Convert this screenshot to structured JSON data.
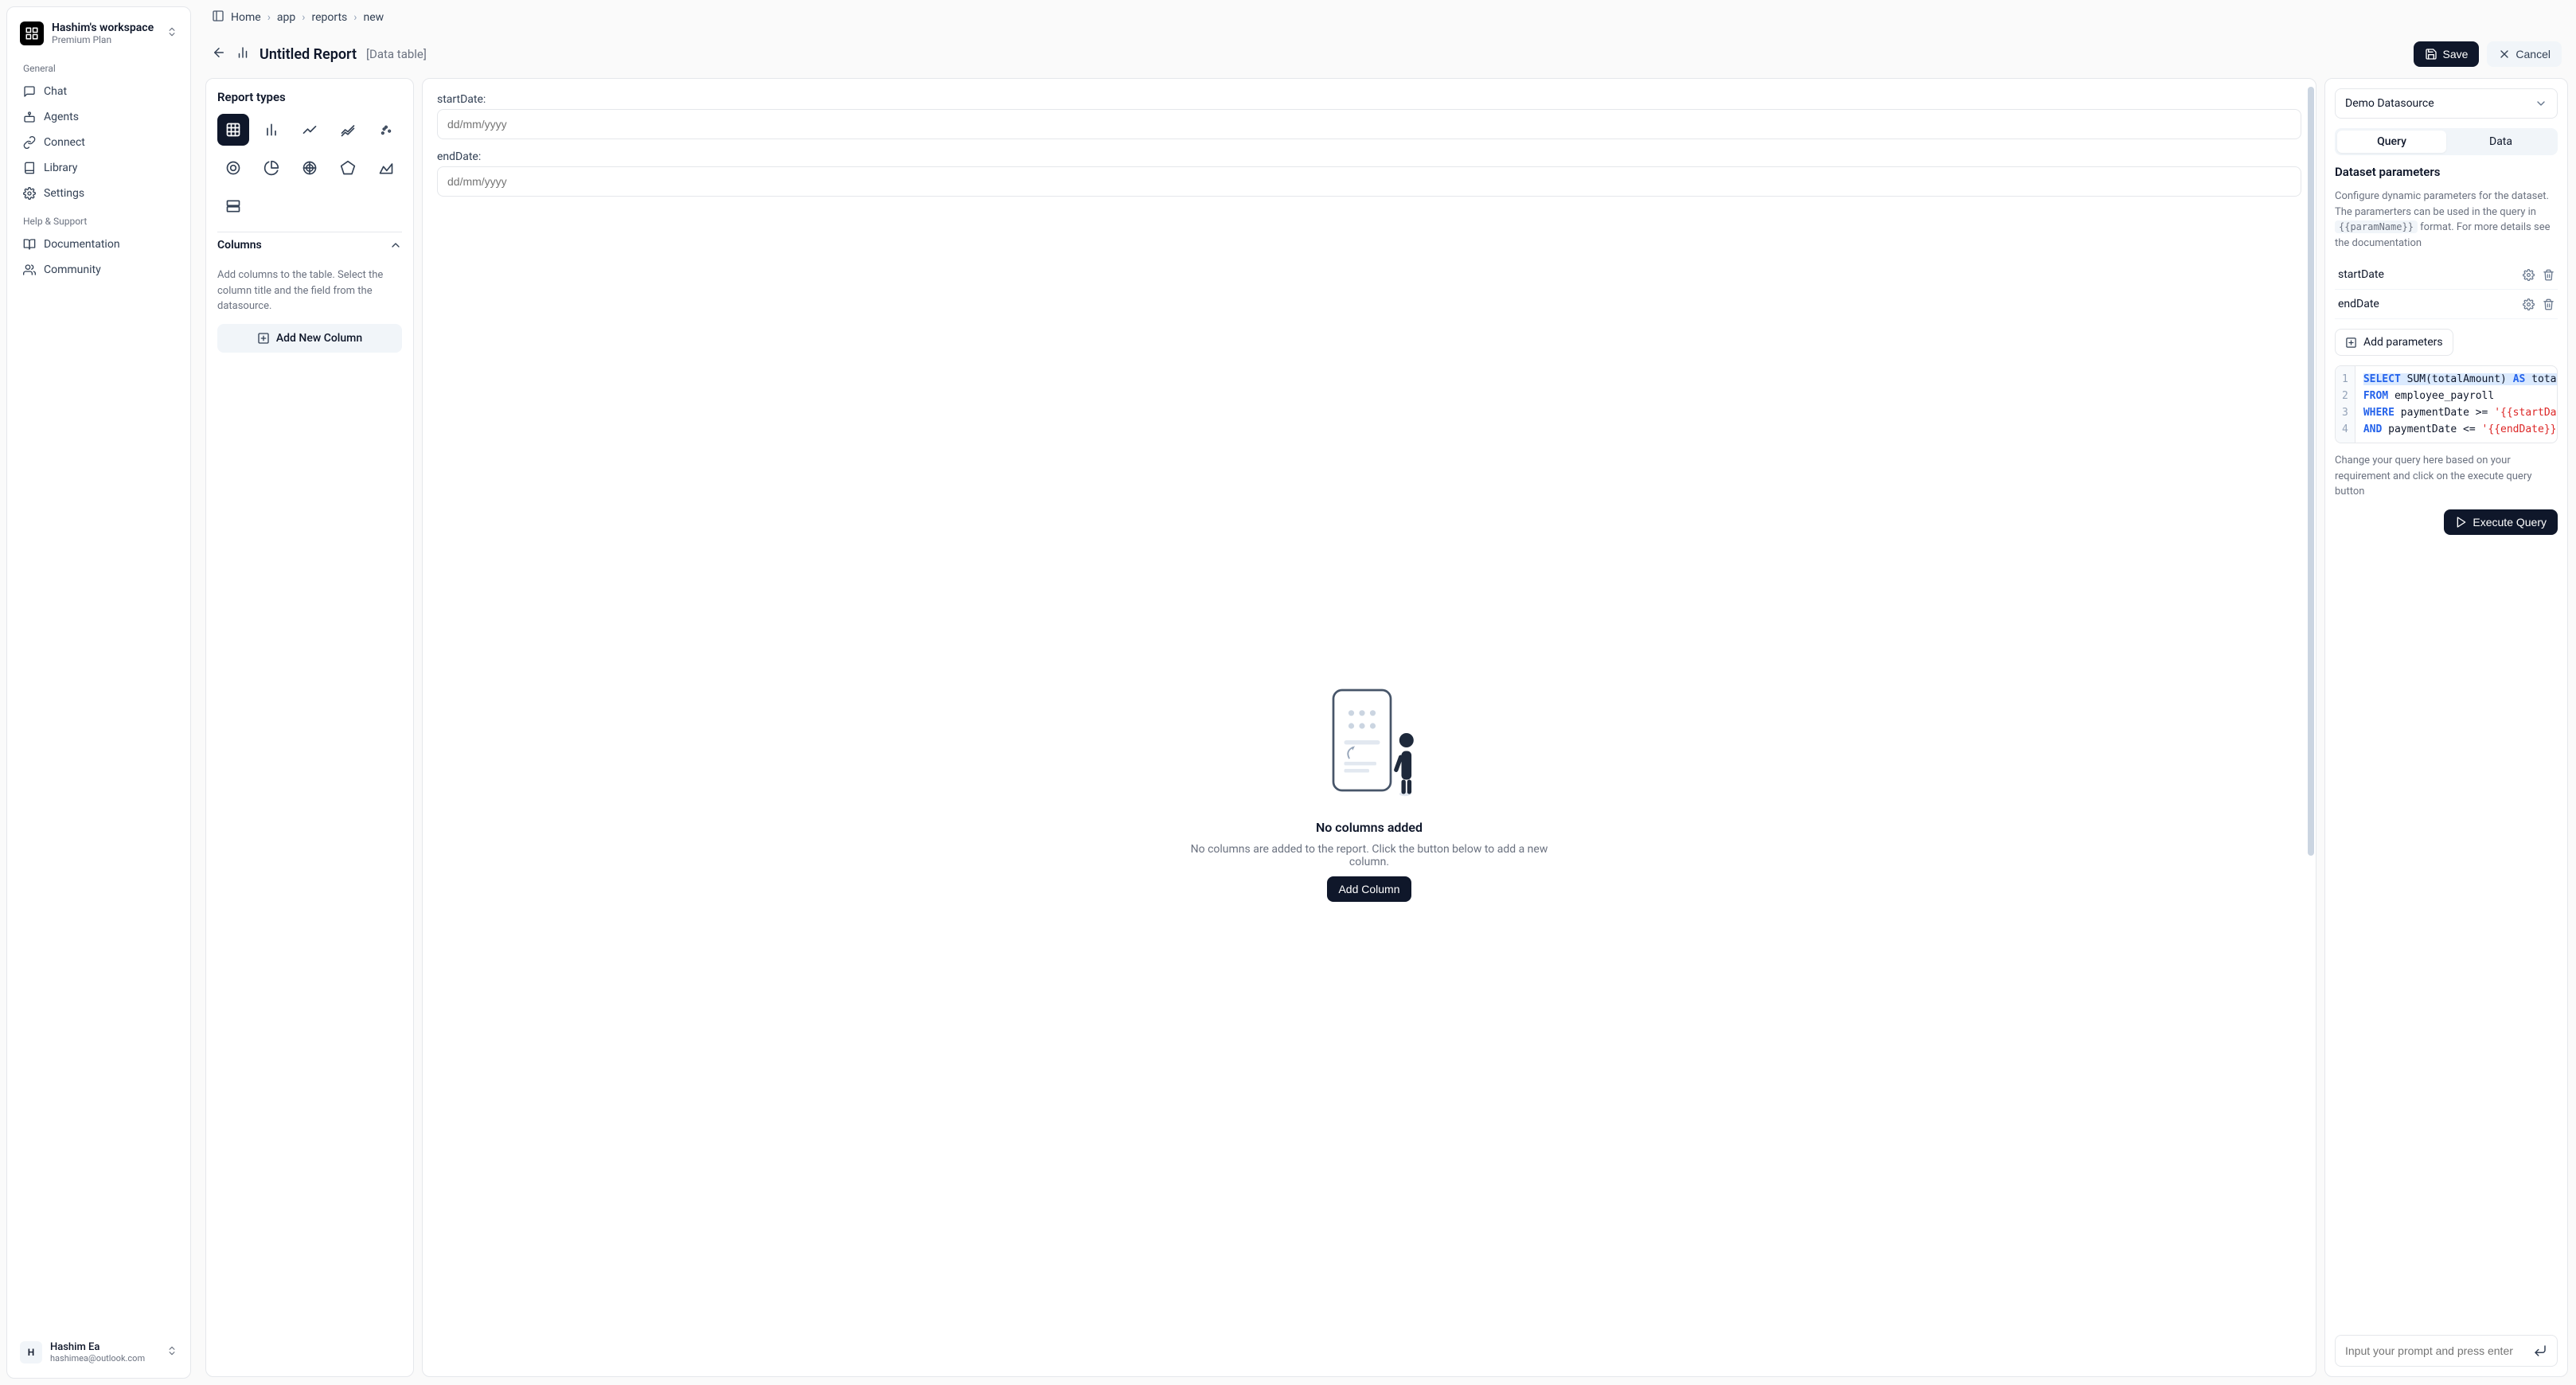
{
  "workspace": {
    "name": "Hashim's workspace",
    "plan": "Premium Plan"
  },
  "nav": {
    "section1": "General",
    "items1": [
      "Chat",
      "Agents",
      "Connect",
      "Library",
      "Settings"
    ],
    "section2": "Help & Support",
    "items2": [
      "Documentation",
      "Community"
    ]
  },
  "user": {
    "initial": "H",
    "name": "Hashim Ea",
    "email": "hashimea@outlook.com"
  },
  "breadcrumb": [
    "Home",
    "app",
    "reports",
    "new"
  ],
  "report": {
    "title": "Untitled Report",
    "subtitle": "[Data table]"
  },
  "actions": {
    "save": "Save",
    "cancel": "Cancel"
  },
  "config": {
    "types_title": "Report types",
    "columns_title": "Columns",
    "columns_help": "Add columns to the table. Select the column title and the field from the datasource.",
    "add_column": "Add New Column"
  },
  "canvas": {
    "field1_label": "startDate:",
    "field2_label": "endDate:",
    "date_placeholder": "dd/mm/yyyy",
    "empty_title": "No columns added",
    "empty_desc": "No columns are added to the report. Click the button below to add a new column.",
    "add_column": "Add Column"
  },
  "right": {
    "datasource": "Demo Datasource",
    "tab_query": "Query",
    "tab_data": "Data",
    "params_title": "Dataset parameters",
    "params_desc_pre": "Configure dynamic parameters for the dataset. The paramerters can be used in the query in ",
    "params_desc_code": "{{paramName}}",
    "params_desc_post": " format. For more details see the documentation",
    "params": [
      "startDate",
      "endDate"
    ],
    "add_params": "Add parameters",
    "query": {
      "l1a": "SELECT",
      "l1b": "SUM(totalAmount)",
      "l1c": "AS",
      "l1d": "total_payroll",
      "l2a": "FROM",
      "l2b": "employee_payroll",
      "l3a": "WHERE",
      "l3b": "paymentDate >= ",
      "l3c": "'{{startDate}}'",
      "l4a": "AND",
      "l4b": "paymentDate <= ",
      "l4c": "'{{endDate}}'"
    },
    "query_help": "Change your query here based on your requirement and click on the execute query button",
    "execute": "Execute Query",
    "prompt_placeholder": "Input your prompt and press enter"
  }
}
